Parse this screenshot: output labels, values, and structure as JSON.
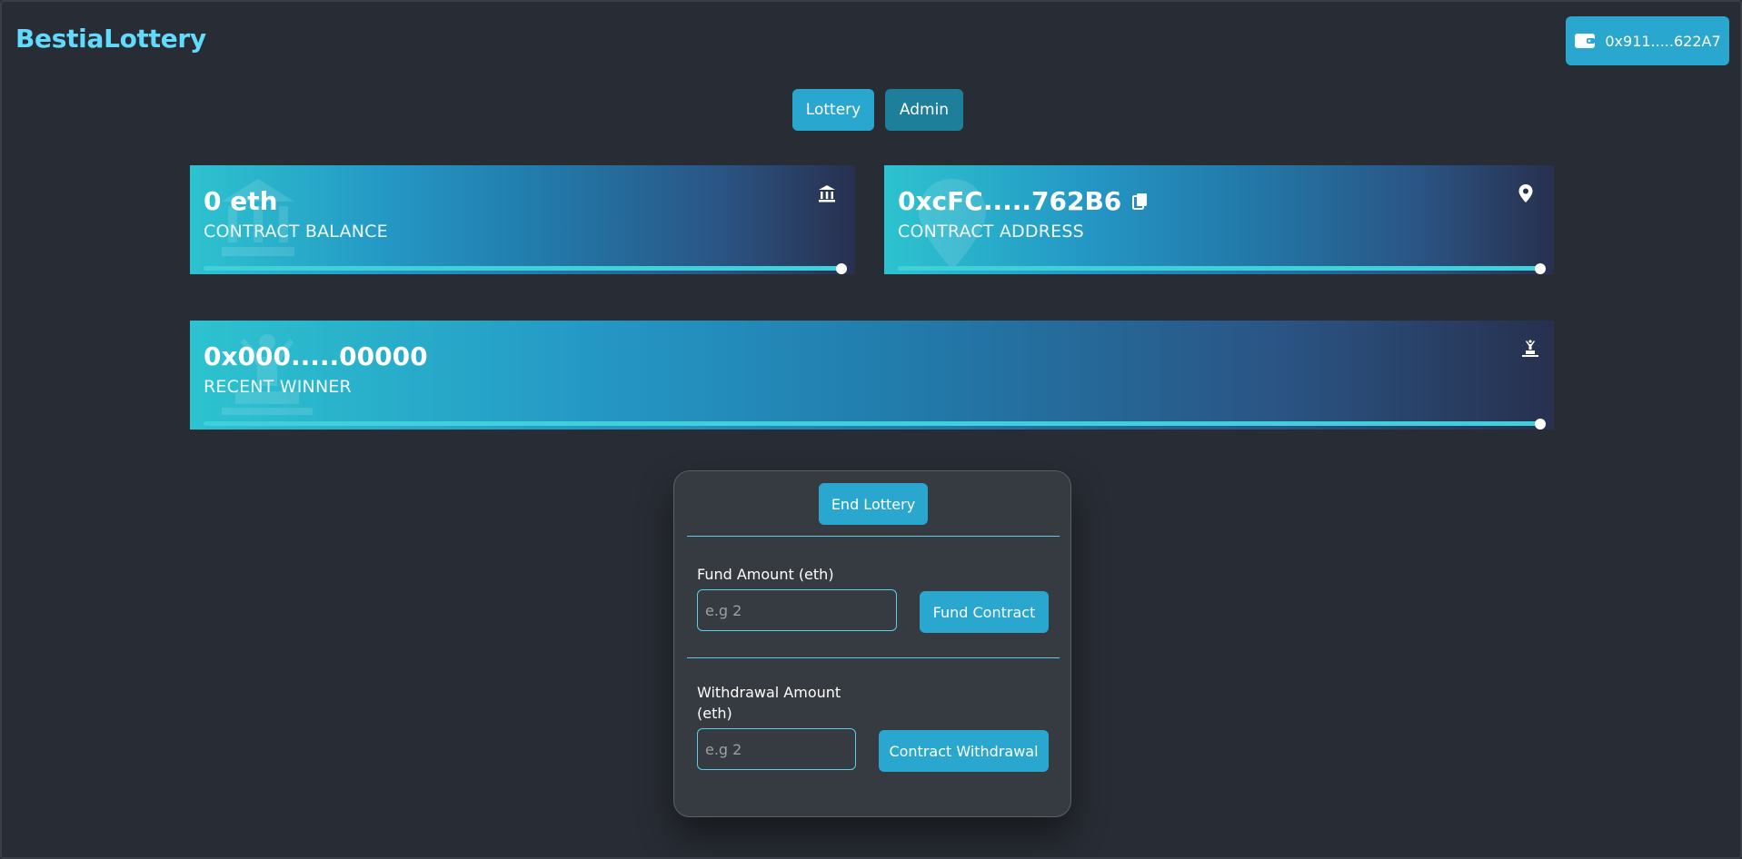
{
  "app": {
    "brand": "BestiaLottery",
    "wallet_address": "0x911.....622A7"
  },
  "nav": {
    "tabs": [
      {
        "label": "Lottery"
      },
      {
        "label": "Admin"
      }
    ]
  },
  "cards": {
    "balance": {
      "value": "0 eth",
      "label": "CONTRACT BALANCE",
      "icon": "bank-icon",
      "progress": 1.0
    },
    "address": {
      "value": "0xcFC.....762B6",
      "label": "CONTRACT ADDRESS",
      "icon": "map-pin-icon",
      "copy_icon": "copy-icon",
      "progress": 1.0
    },
    "winner": {
      "value": "0x000.....00000",
      "label": "RECENT WINNER",
      "icon": "winner-podium-icon",
      "progress": 1.0
    }
  },
  "admin_panel": {
    "end_lottery_label": "End Lottery",
    "fund": {
      "label": "Fund Amount (eth)",
      "placeholder": "e.g 2",
      "value": "",
      "button": "Fund Contract"
    },
    "withdraw": {
      "label_line1": "Withdrawal Amount",
      "label_line2": "(eth)",
      "placeholder": "e.g 2",
      "value": "",
      "button": "Contract Withdrawal"
    }
  },
  "colors": {
    "background": "#282c34",
    "brand": "#61dafb",
    "accent": "#2aa7cf",
    "panel": "#363a41"
  }
}
